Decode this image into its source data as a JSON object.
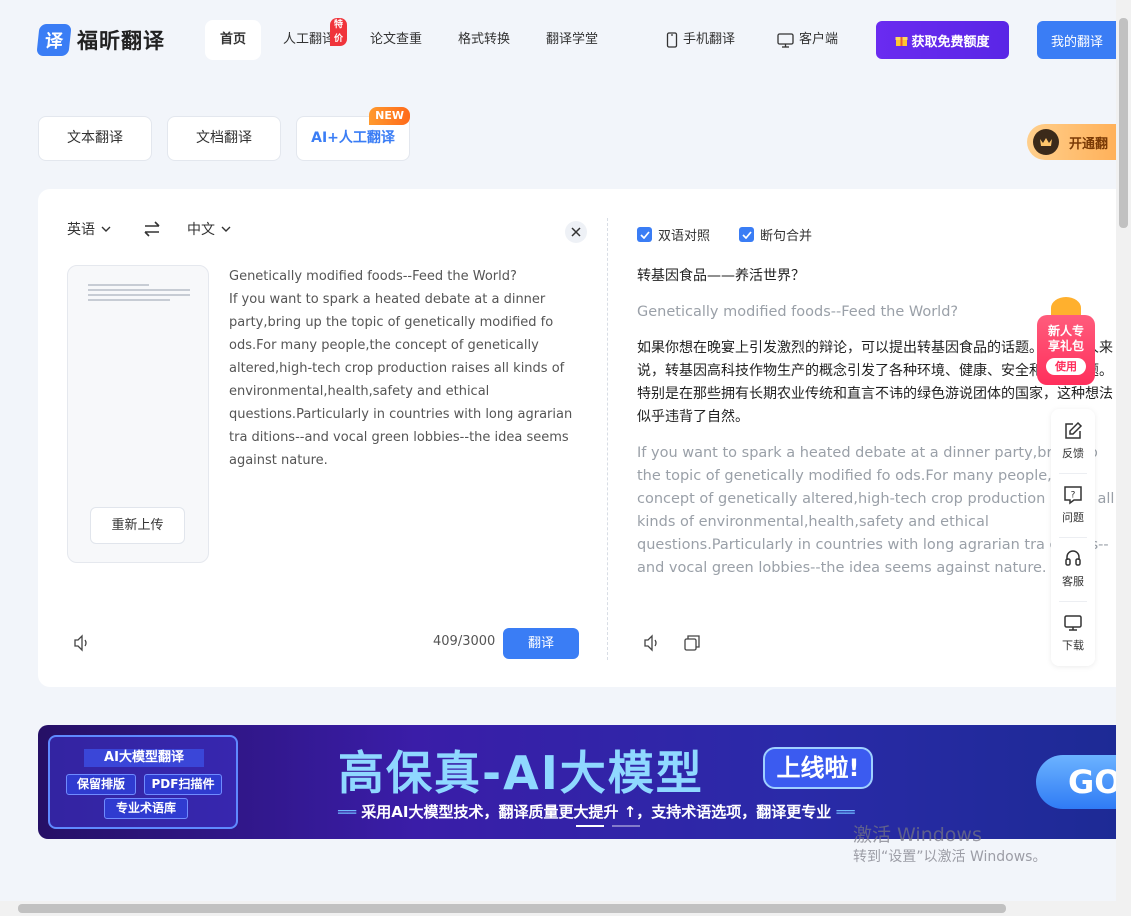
{
  "header": {
    "logo_char": "译",
    "logo_text": "福昕翻译",
    "nav": [
      {
        "label": "首页",
        "active": true
      },
      {
        "label": "人工翻译",
        "badge": "特价"
      },
      {
        "label": "论文查重"
      },
      {
        "label": "格式转换"
      },
      {
        "label": "翻译学堂"
      }
    ],
    "mobile_label": "手机翻译",
    "client_label": "客户端",
    "free_quota_label": "获取免费额度",
    "my_translation_label": "我的翻译"
  },
  "tabs": [
    {
      "label": "文本翻译"
    },
    {
      "label": "文档翻译"
    },
    {
      "label": "AI+人工翻译",
      "badge": "NEW"
    }
  ],
  "vip": {
    "label": "开通翻"
  },
  "source": {
    "language": "英语",
    "target_language": "中文",
    "reupload_label": "重新上传",
    "paragraphs": [
      "Genetically modified foods--Feed the World?",
      "If you want to spark a heated debate at a dinner party,bring up the topic of genetically modified fo ods.For many people,the concept of genetically altered,high-tech crop production raises all kinds of environmental,health,safety and ethical questions.Particularly in countries with long agrarian tra ditions--and vocal green lobbies--the idea seems against nature."
    ],
    "counter": "409/3000",
    "translate_label": "翻译"
  },
  "target": {
    "bilingual_label": "双语对照",
    "merge_label": "断句合并",
    "title_zh": "转基因食品——养活世界？",
    "title_en": "Genetically modified foods--Feed the World?",
    "para_zh": "如果你想在晚宴上引发激烈的辩论，可以提出转基因食品的话题。对许多人来说，转基因高科技作物生产的概念引发了各种环境、健康、安全和伦理问题。特别是在那些拥有长期农业传统和直言不讳的绿色游说团体的国家，这种想法似乎违背了自然。",
    "para_en": "If you want to spark a heated debate at a dinner party,bring up the topic of genetically modified fo ods.For many people,the concept of genetically altered,high-tech crop production raises all kinds of environmental,health,safety and ethical questions.Particularly in countries with long agrarian tra ditions--and vocal green lobbies--the idea seems against nature."
  },
  "gift": {
    "line1": "新人专",
    "line2": "享礼包",
    "use_label": "使用"
  },
  "side_tools": [
    {
      "label": "反馈",
      "icon": "edit-icon"
    },
    {
      "label": "问题",
      "icon": "question-icon"
    },
    {
      "label": "客服",
      "icon": "headset-icon"
    },
    {
      "label": "下载",
      "icon": "monitor-icon"
    }
  ],
  "banner": {
    "box_title": "AI大模型翻译",
    "chips": [
      "保留排版",
      "PDF扫描件",
      "专业术语库"
    ],
    "headline": "高保真-AI大模型",
    "live_label": "上线啦!",
    "subtitle": "采用AI大模型技术，翻译质量更大提升 ↑，支持术语选项，翻译更专业",
    "go_label": "GO"
  },
  "watermark": {
    "line1": "激活 Windows",
    "line2": "转到“设置”以激活 Windows。"
  },
  "colors": {
    "primary": "#3a7df5",
    "purple": "#5a26e6",
    "page_bg": "#f2f5fa"
  }
}
